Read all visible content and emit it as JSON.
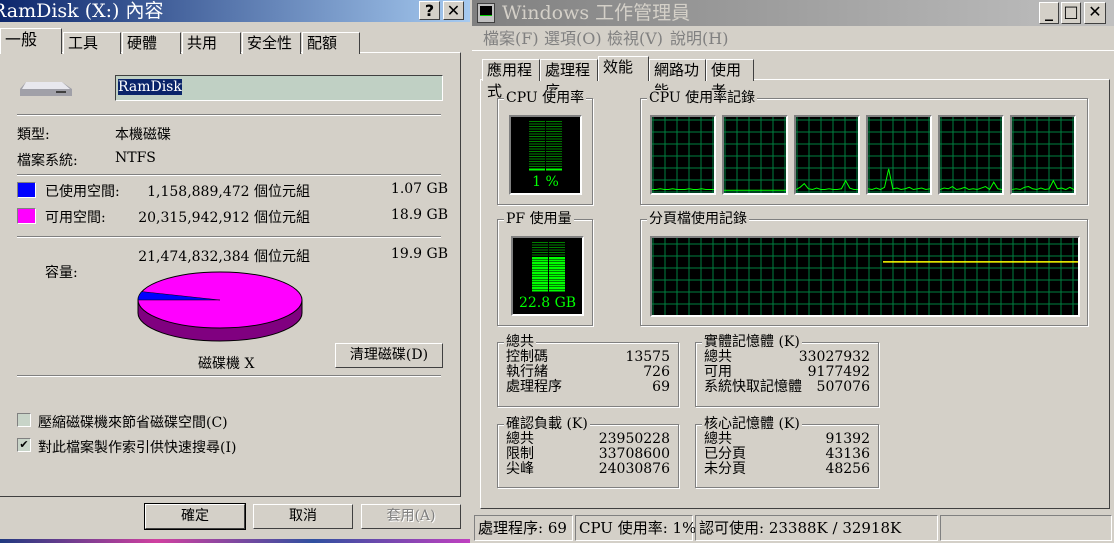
{
  "props": {
    "title": "RamDisk (X:) 內容",
    "help_btn": "?",
    "close_btn": "✕",
    "tabs": [
      "一般",
      "工具",
      "硬體",
      "共用",
      "安全性",
      "配額"
    ],
    "name_value": "RamDisk",
    "type_label": "類型:",
    "type_value": "本機磁碟",
    "fs_label": "檔案系統:",
    "fs_value": "NTFS",
    "used_label": "已使用空間:",
    "used_bytes": "1,158,889,472 個位元組",
    "used_gb": "1.07 GB",
    "free_label": "可用空間:",
    "free_bytes": "20,315,942,912 個位元組",
    "free_gb": "18.9 GB",
    "cap_label": "容量:",
    "cap_bytes": "21,474,832,384 個位元組",
    "cap_gb": "19.9 GB",
    "used_color": "#0000ff",
    "free_color": "#ff00ff",
    "used_fraction": 0.054,
    "drive_label": "磁碟機 X",
    "cleanup_btn": "清理磁碟(D)",
    "compress_label": "壓縮磁碟機來節省磁碟空間(C)",
    "compress_checked": false,
    "index_label": "對此檔案製作索引供快速搜尋(I)",
    "index_checked": true,
    "ok": "確定",
    "cancel": "取消",
    "apply": "套用(A)"
  },
  "tm": {
    "title": "Windows 工作管理員",
    "min": "_",
    "max": "□",
    "close": "✕",
    "menu": [
      "檔案(F)",
      "選項(O)",
      "檢視(V)",
      "說明(H)"
    ],
    "tabs": [
      "應用程式",
      "處理程序",
      "效能",
      "網路功能",
      "使用者"
    ],
    "cpu_usage_title": "CPU 使用率",
    "cpu_usage_value": "1 %",
    "cpu_percent": 1,
    "cpu_history_title": "CPU 使用率記錄",
    "cpu_history": [
      [
        2,
        2,
        3,
        2,
        2,
        3,
        2,
        2,
        2,
        3,
        2,
        2,
        3,
        2,
        2,
        2
      ],
      [
        1,
        1,
        1,
        1,
        1,
        1,
        1,
        1,
        1,
        1,
        1,
        1,
        1,
        1,
        1,
        1
      ],
      [
        2,
        5,
        10,
        3,
        2,
        4,
        2,
        2,
        3,
        2,
        2,
        3,
        14,
        4,
        2,
        2
      ],
      [
        3,
        2,
        4,
        2,
        5,
        30,
        3,
        4,
        2,
        3,
        5,
        2,
        3,
        4,
        2,
        3
      ],
      [
        2,
        4,
        3,
        6,
        2,
        3,
        5,
        2,
        3,
        2,
        4,
        6,
        2,
        12,
        3,
        2
      ],
      [
        2,
        3,
        2,
        5,
        6,
        3,
        2,
        4,
        2,
        3,
        14,
        3,
        4,
        2,
        5,
        2
      ]
    ],
    "pf_title": "PF 使用量",
    "pf_value": "22.8 GB",
    "pf_fraction": 0.69,
    "pf_history_title": "分頁檔使用記錄",
    "pf_history_fraction": 0.69,
    "totals": {
      "title": "總共",
      "rows": [
        [
          "控制碼",
          "13575"
        ],
        [
          "執行緒",
          "726"
        ],
        [
          "處理程序",
          "69"
        ]
      ]
    },
    "physical": {
      "title": "實體記憶體 (K)",
      "rows": [
        [
          "總共",
          "33027932"
        ],
        [
          "可用",
          "9177492"
        ],
        [
          "系統快取記憶體",
          "507076"
        ]
      ]
    },
    "commit": {
      "title": "確認負載 (K)",
      "rows": [
        [
          "總共",
          "23950228"
        ],
        [
          "限制",
          "33708600"
        ],
        [
          "尖峰",
          "24030876"
        ]
      ]
    },
    "kernel": {
      "title": "核心記憶體 (K)",
      "rows": [
        [
          "總共",
          "91392"
        ],
        [
          "已分頁",
          "43136"
        ],
        [
          "未分頁",
          "48256"
        ]
      ]
    },
    "status": [
      "處理程序: 69",
      "CPU 使用率: 1%",
      "認可使用: 23388K / 32918K"
    ]
  }
}
